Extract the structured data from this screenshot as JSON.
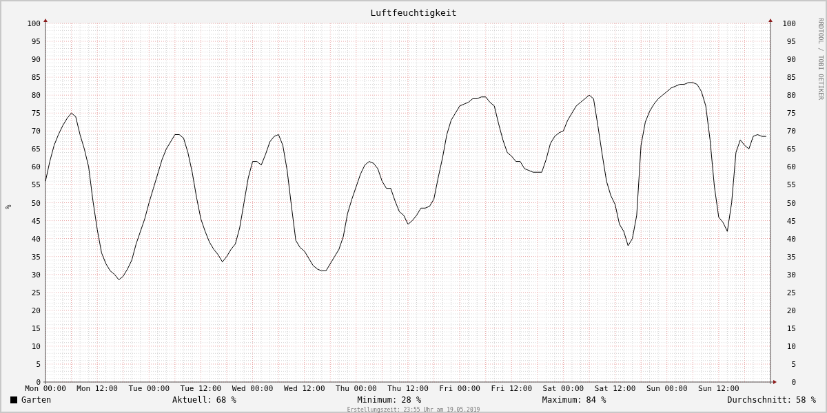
{
  "title": "Luftfeuchtigkeit",
  "chart": {
    "right_axis_labels": [
      "100",
      "95",
      "90",
      "85",
      "80",
      "75",
      "70",
      "65",
      "60",
      "55",
      "50",
      "45",
      "40",
      "35",
      "30",
      "25",
      "20",
      "15",
      "10",
      "5",
      "0"
    ],
    "chart_data": {
      "type": "line",
      "ylabel": "%",
      "grid": true,
      "ylim": [
        0,
        100
      ],
      "categories": [
        "Mon 00:00",
        null,
        null,
        null,
        null,
        null,
        null,
        null,
        null,
        null,
        null,
        null,
        "Mon 12:00",
        null,
        null,
        null,
        null,
        null,
        null,
        null,
        null,
        null,
        null,
        null,
        "Tue 00:00",
        null,
        null,
        null,
        null,
        null,
        null,
        null,
        null,
        null,
        null,
        null,
        "Tue 12:00",
        null,
        null,
        null,
        null,
        null,
        null,
        null,
        null,
        null,
        null,
        null,
        "Wed 00:00",
        null,
        null,
        null,
        null,
        null,
        null,
        null,
        null,
        null,
        null,
        null,
        "Wed 12:00",
        null,
        null,
        null,
        null,
        null,
        null,
        null,
        null,
        null,
        null,
        null,
        "Thu 00:00",
        null,
        null,
        null,
        null,
        null,
        null,
        null,
        null,
        null,
        null,
        null,
        "Thu 12:00",
        null,
        null,
        null,
        null,
        null,
        null,
        null,
        null,
        null,
        null,
        null,
        "Fri 00:00",
        null,
        null,
        null,
        null,
        null,
        null,
        null,
        null,
        null,
        null,
        null,
        "Fri 12:00",
        null,
        null,
        null,
        null,
        null,
        null,
        null,
        null,
        null,
        null,
        null,
        "Sat 00:00",
        null,
        null,
        null,
        null,
        null,
        null,
        null,
        null,
        null,
        null,
        null,
        "Sat 12:00",
        null,
        null,
        null,
        null,
        null,
        null,
        null,
        null,
        null,
        null,
        null,
        "Sun 00:00",
        null,
        null,
        null,
        null,
        null,
        null,
        null,
        null,
        null,
        null,
        null,
        "Sun 12:00",
        null,
        null,
        null,
        null,
        null,
        null,
        null,
        null,
        null,
        null,
        null
      ],
      "yticks": [
        0,
        5,
        10,
        15,
        20,
        25,
        30,
        35,
        40,
        45,
        50,
        55,
        60,
        65,
        70,
        75,
        80,
        85,
        90,
        95,
        100
      ],
      "series": [
        {
          "name": "Garten",
          "color": "#000000",
          "values": [
            56,
            61.5,
            66,
            69,
            71.5,
            73.5,
            75,
            74,
            69,
            65,
            60,
            50.5,
            42.5,
            36,
            33,
            31,
            30,
            28.5,
            29.5,
            31.5,
            34,
            38.5,
            42,
            45.5,
            50,
            54,
            58,
            62,
            65,
            67,
            69,
            69,
            68,
            64,
            58.5,
            51.5,
            45.5,
            42,
            39,
            37,
            35.5,
            33.5,
            35,
            37,
            38.5,
            43,
            50,
            57,
            61.5,
            61.5,
            60.5,
            63.5,
            67,
            68.5,
            69,
            66,
            59,
            49,
            39.5,
            37.5,
            36.5,
            34.5,
            32.5,
            31.5,
            31,
            31,
            33,
            35,
            37,
            40.5,
            47,
            51,
            54.5,
            58,
            60.5,
            61.5,
            61,
            59.5,
            56,
            54,
            54,
            50.5,
            47.5,
            46.5,
            44,
            45,
            46.5,
            48.5,
            48.5,
            49,
            51,
            57,
            62.5,
            69,
            73,
            75,
            77,
            77.5,
            78,
            79,
            79,
            79.5,
            79.5,
            78,
            77,
            72,
            67.5,
            64,
            63,
            61.5,
            61.5,
            59.5,
            59,
            58.5,
            58.5,
            58.5,
            62,
            66.5,
            68.5,
            69.5,
            70,
            73,
            75,
            77,
            78,
            79,
            80,
            79,
            71.5,
            63.5,
            56,
            52,
            49.5,
            44,
            42,
            38,
            40,
            46.5,
            66,
            72.5,
            75.5,
            77.5,
            79,
            80,
            81,
            82,
            82.5,
            83,
            83,
            83.5,
            83.5,
            83,
            81,
            77,
            67.5,
            54.5,
            46,
            44.5,
            42,
            50,
            64,
            67.5,
            66,
            65,
            68.5,
            69,
            68.5,
            68.5
          ]
        }
      ]
    }
  },
  "side_note": "RRDTOOL / TOBI OETIKER",
  "stats": [
    {
      "label": "Aktuell:",
      "value": "68 %"
    },
    {
      "label": "Minimum:",
      "value": "28 %"
    },
    {
      "label": "Maximum:",
      "value": "84 %"
    },
    {
      "label": "Durchschnitt:",
      "value": "58 %"
    }
  ],
  "footer": "Erstellungszeit: 23:55 Uhr am 19.05.2019"
}
